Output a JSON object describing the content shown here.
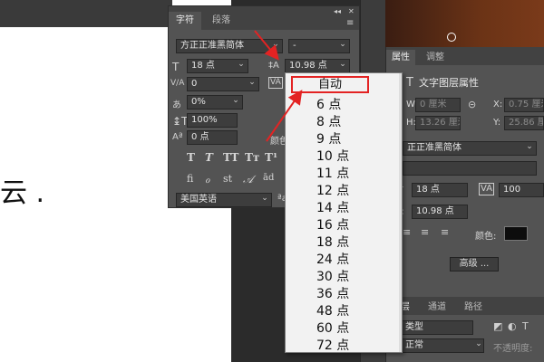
{
  "document": {
    "text_fragment": "云 ."
  },
  "character_panel": {
    "tabs": [
      "字符",
      "段落"
    ],
    "collapse": "◂◂",
    "close": "✕",
    "menu": "≡",
    "font_family": "方正正准黑简体",
    "font_style": "-",
    "font_size": "18 点",
    "leading": "10.98 点",
    "kerning": "0",
    "tracking": "0%",
    "vertical_scale": "100%",
    "baseline_shift": "0 点",
    "color_label": "颜色",
    "language": "美国英语",
    "style_glyphs": [
      "T",
      "T",
      "TT",
      "Tт",
      "T¹"
    ],
    "opentype_glyphs": [
      "fi",
      "ℴ",
      "st",
      "𝒜",
      "ād"
    ]
  },
  "leading_dropdown": {
    "selected": "自动",
    "options": [
      "6 点",
      "8 点",
      "9 点",
      "10 点",
      "11 点",
      "12 点",
      "14 点",
      "16 点",
      "18 点",
      "24 点",
      "30 点",
      "36 点",
      "48 点",
      "60 点",
      "72 点"
    ]
  },
  "properties_panel": {
    "tabs": [
      "属性",
      "调整"
    ],
    "section": "文字图层属性",
    "w_label": "W:",
    "w_value": "0 厘米",
    "x_label": "X:",
    "x_value": "0.75 厘米",
    "h_label": "H:",
    "h_value": "13.26 厘米",
    "y_label": "Y:",
    "y_value": "25.86 厘米",
    "font_family": "正正准黑简体",
    "font_size": "18 点",
    "tracking": "100",
    "leading": "10.98 点",
    "color_label": "颜色:",
    "advanced_button": "高级 ...",
    "layers_tabs": [
      "图层",
      "通道",
      "路径"
    ],
    "layer_filter": "类型",
    "blend_mode": "正常",
    "opacity_label": "不透明度:"
  },
  "colors": {
    "highlight": "#e32323",
    "panel": "#535353",
    "field": "#3d3d3d"
  }
}
